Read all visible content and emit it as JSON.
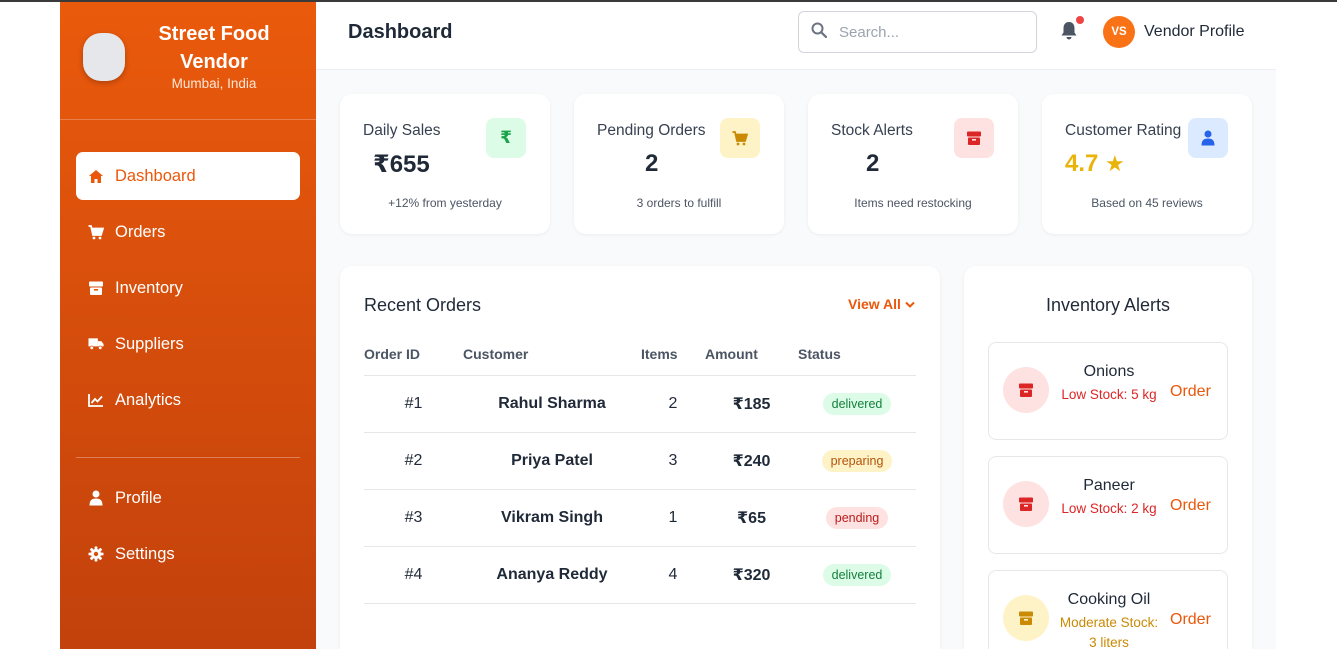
{
  "sidebar": {
    "brand_name": "Street Food Vendor",
    "brand_location": "Mumbai, India",
    "items": [
      {
        "label": "Dashboard",
        "icon": "home-icon"
      },
      {
        "label": "Orders",
        "icon": "cart-icon"
      },
      {
        "label": "Inventory",
        "icon": "box-icon"
      },
      {
        "label": "Suppliers",
        "icon": "truck-icon"
      },
      {
        "label": "Analytics",
        "icon": "chart-icon"
      }
    ],
    "bottom_items": [
      {
        "label": "Profile",
        "icon": "user-icon"
      },
      {
        "label": "Settings",
        "icon": "gear-icon"
      }
    ]
  },
  "header": {
    "title": "Dashboard",
    "search_placeholder": "Search...",
    "avatar_initials": "VS",
    "profile_label": "Vendor Profile"
  },
  "stats": [
    {
      "label": "Daily Sales",
      "value": "₹655",
      "sub": "+12% from yesterday",
      "icon": "rupee-icon",
      "color": "#16a34a"
    },
    {
      "label": "Pending Orders",
      "value": "2",
      "sub": "3 orders to fulfill",
      "icon": "cart-icon",
      "color": "#ca8a04"
    },
    {
      "label": "Stock Alerts",
      "value": "2",
      "sub": "Items need restocking",
      "icon": "box-icon",
      "color": "#dc2626"
    },
    {
      "label": "Customer Rating",
      "value": "4.7",
      "sub": "Based on 45 reviews",
      "icon": "user-icon",
      "color": "#2563eb"
    }
  ],
  "orders": {
    "title": "Recent Orders",
    "view_all": "View All",
    "columns": [
      "Order ID",
      "Customer",
      "Items",
      "Amount",
      "Status"
    ],
    "rows": [
      {
        "id": "#1",
        "customer": "Rahul Sharma",
        "items": "2",
        "amount": "₹185",
        "status": "delivered"
      },
      {
        "id": "#2",
        "customer": "Priya Patel",
        "items": "3",
        "amount": "₹240",
        "status": "preparing"
      },
      {
        "id": "#3",
        "customer": "Vikram Singh",
        "items": "1",
        "amount": "₹65",
        "status": "pending"
      },
      {
        "id": "#4",
        "customer": "Ananya Reddy",
        "items": "4",
        "amount": "₹320",
        "status": "delivered"
      }
    ]
  },
  "inventory_alerts": {
    "title": "Inventory Alerts",
    "items": [
      {
        "name": "Onions",
        "desc": "Low Stock: 5 kg",
        "action": "Order",
        "color": "#dc2626"
      },
      {
        "name": "Paneer",
        "desc": "Low Stock: 2 kg",
        "action": "Order",
        "color": "#dc2626"
      },
      {
        "name": "Cooking Oil",
        "desc": "Moderate Stock: 3 liters",
        "action": "Order",
        "color": "#ca8a04"
      }
    ]
  },
  "colors": {
    "accent": "#ea580c",
    "sidebar_top": "#ea5a0c",
    "sidebar_bottom": "#c2410c"
  }
}
